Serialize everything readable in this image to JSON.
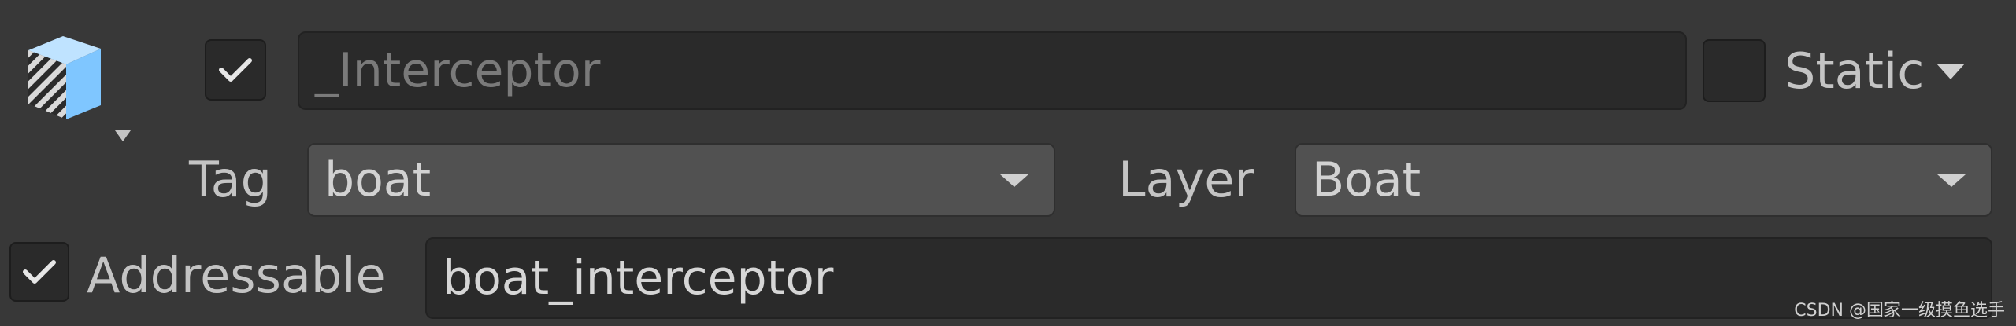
{
  "header": {
    "active_checked": true,
    "name_value": "_Interceptor",
    "static_checked": false,
    "static_label": "Static"
  },
  "tag": {
    "label": "Tag",
    "value": "boat"
  },
  "layer": {
    "label": "Layer",
    "value": "Boat"
  },
  "addressable": {
    "checked": true,
    "label": "Addressable",
    "value": "boat_interceptor"
  },
  "icons": {
    "prefab": "prefab-cube-icon",
    "check": "checkmark-icon",
    "caret": "caret-down-icon"
  },
  "colors": {
    "background": "#383838",
    "field": "#2a2a2a",
    "dropdown": "#515151",
    "icon_blue": "#7fc6ff"
  },
  "watermark": "CSDN @国家一级摸鱼选手"
}
